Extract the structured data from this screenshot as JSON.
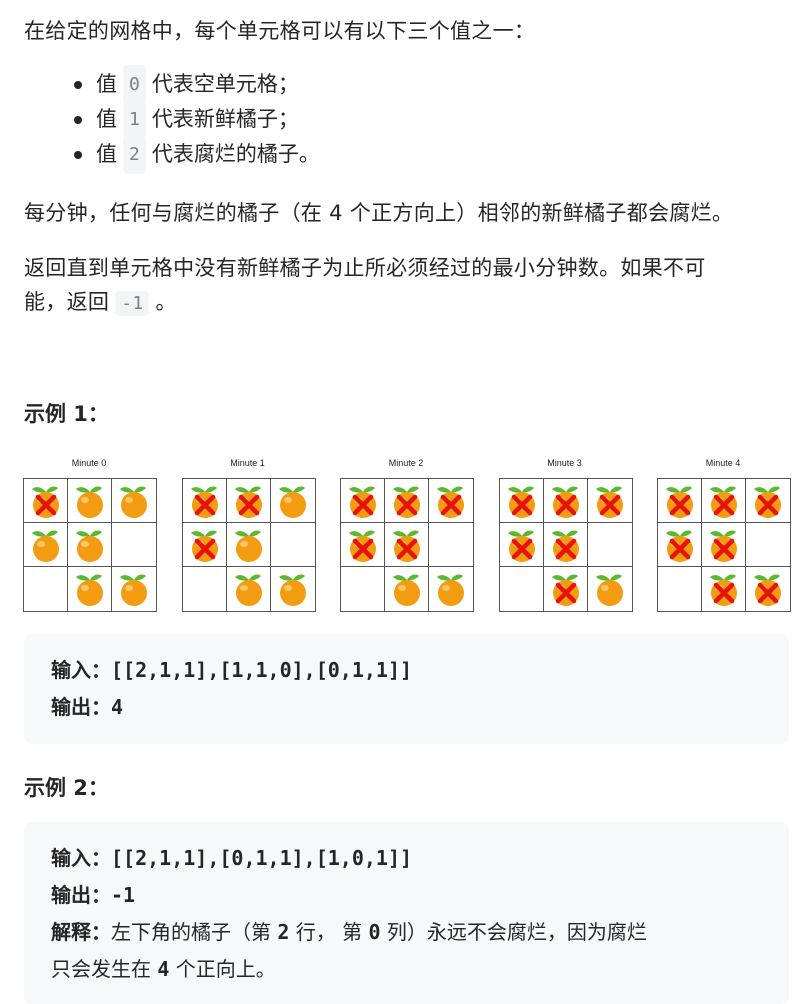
{
  "intro": "在给定的网格中，每个单元格可以有以下三个值之一：",
  "bullets": [
    {
      "prefix": "值",
      "code": "0",
      "suffix": "代表空单元格；"
    },
    {
      "prefix": "值",
      "code": "1",
      "suffix": "代表新鲜橘子；"
    },
    {
      "prefix": "值",
      "code": "2",
      "suffix": "代表腐烂的橘子。"
    }
  ],
  "rule": "每分钟，任何与腐烂的橘子（在 4 个正方向上）相邻的新鲜橘子都会腐烂。",
  "question_line1": "返回直到单元格中没有新鲜橘子为止所必须经过的最小分钟数。如果不可",
  "question_line2_prefix": "能，返回",
  "question_code": "-1",
  "question_line2_suffix": "。",
  "example1": {
    "heading": "示例 1：",
    "figure": {
      "panels": [
        {
          "title": "Minute 0",
          "grid": [
            [
              "rotten",
              "fresh",
              "fresh"
            ],
            [
              "fresh",
              "fresh",
              "empty"
            ],
            [
              "empty",
              "fresh",
              "fresh"
            ]
          ]
        },
        {
          "title": "Minute 1",
          "grid": [
            [
              "rotten",
              "rotten",
              "fresh"
            ],
            [
              "rotten",
              "fresh",
              "empty"
            ],
            [
              "empty",
              "fresh",
              "fresh"
            ]
          ]
        },
        {
          "title": "Minute 2",
          "grid": [
            [
              "rotten",
              "rotten",
              "rotten"
            ],
            [
              "rotten",
              "rotten",
              "empty"
            ],
            [
              "empty",
              "fresh",
              "fresh"
            ]
          ]
        },
        {
          "title": "Minute 3",
          "grid": [
            [
              "rotten",
              "rotten",
              "rotten"
            ],
            [
              "rotten",
              "rotten",
              "empty"
            ],
            [
              "empty",
              "rotten",
              "fresh"
            ]
          ]
        },
        {
          "title": "Minute 4",
          "grid": [
            [
              "rotten",
              "rotten",
              "rotten"
            ],
            [
              "rotten",
              "rotten",
              "empty"
            ],
            [
              "empty",
              "rotten",
              "rotten"
            ]
          ]
        }
      ],
      "colors": {
        "orange": "#f39c12",
        "leaf": "#5cb82e",
        "x_mark": "#e8120c",
        "border": "#555555"
      }
    },
    "input_label": "输入：",
    "input_value": "[[2,1,1],[1,1,0],[0,1,1]]",
    "output_label": "输出：",
    "output_value": "4"
  },
  "example2": {
    "heading": "示例 2：",
    "input_label": "输入：",
    "input_value": "[[2,1,1],[0,1,1],[1,0,1]]",
    "output_label": "输出：",
    "output_value": "-1",
    "explain_label": "解释：",
    "explain_part1": "左下角的橘子（第 ",
    "explain_num1": "2",
    "explain_part2": " 行， 第 ",
    "explain_num2": "0",
    "explain_part3": " 列）永远不会腐烂，因为腐烂",
    "explain_line2_part1": "只会发生在 ",
    "explain_line2_num": "4",
    "explain_line2_part2": " 个正向上。"
  }
}
